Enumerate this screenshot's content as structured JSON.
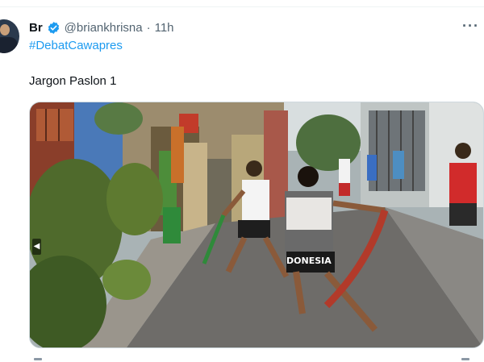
{
  "tweet": {
    "author_name": "Br",
    "handle": "@briankhrisna",
    "separator": "·",
    "time": "11h",
    "hashtag": "#DebatCawapres",
    "text": "Jargon Paslon 1",
    "more_label": "···"
  },
  "media": {
    "shirt_text": "DONESIA",
    "nav_prev": "◀"
  },
  "colors": {
    "accent": "#1d9bf0",
    "text_primary": "#0f1419",
    "text_secondary": "#536471"
  },
  "icons": [
    "verified-badge-icon",
    "more-options-icon",
    "media-prev-arrow-icon"
  ]
}
